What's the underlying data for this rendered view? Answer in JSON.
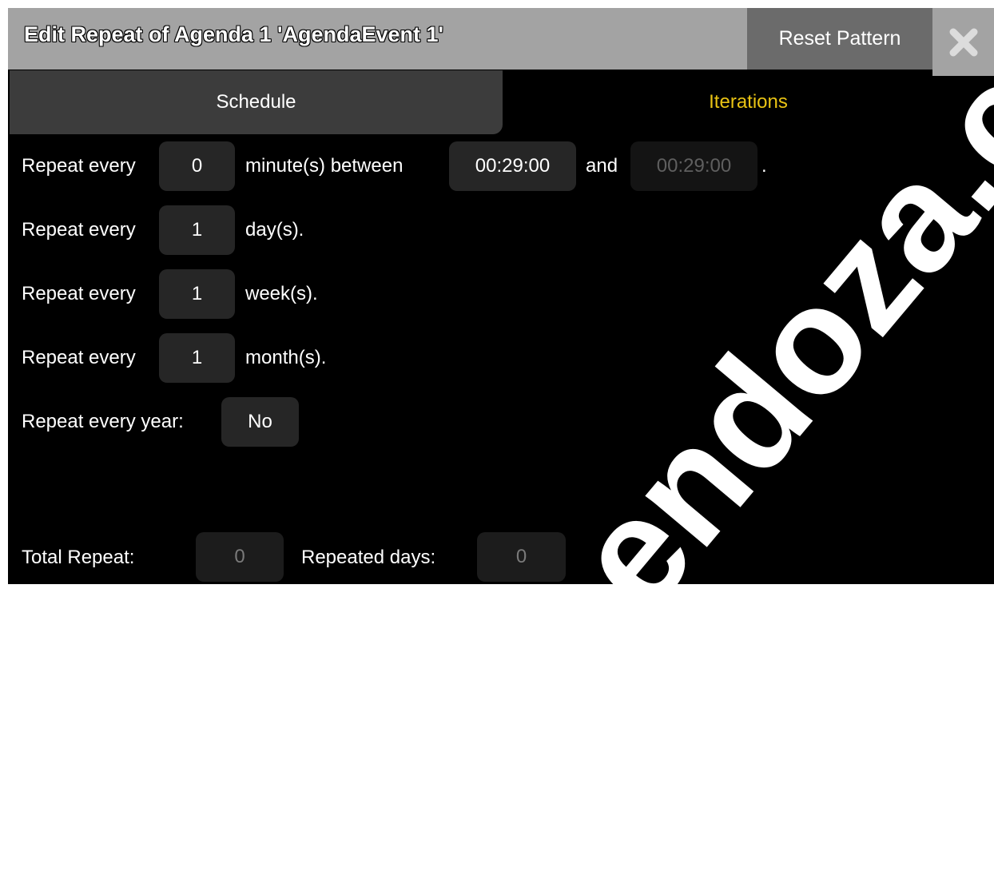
{
  "window": {
    "title": "Edit Repeat of Agenda 1 'AgendaEvent 1'",
    "reset_label": "Reset Pattern",
    "close_icon": "close-x-icon"
  },
  "tabs": {
    "schedule": "Schedule",
    "iterations": "Iterations",
    "active": "Schedule"
  },
  "rows": {
    "minutes": {
      "prefix": "Repeat every",
      "value": "0",
      "middle": "minute(s) between",
      "start": "00:29:00",
      "and": "and",
      "end": "00:29:00",
      "suffix": "."
    },
    "days": {
      "prefix": "Repeat every",
      "value": "1",
      "suffix": "day(s)."
    },
    "weeks": {
      "prefix": "Repeat every",
      "value": "1",
      "suffix": "week(s)."
    },
    "months": {
      "prefix": "Repeat every",
      "value": "1",
      "suffix": "month(s)."
    },
    "year": {
      "label": "Repeat every year:",
      "value": "No"
    }
  },
  "footer": {
    "total_label": "Total Repeat:",
    "total_value": "0",
    "days_label": "Repeated days:",
    "days_value": "0"
  },
  "watermark": "asmendoza.com",
  "colors": {
    "title_bar": "#a3a3a3",
    "reset_button": "#6b6b6b",
    "active_tab": "#3c3c3c",
    "inactive_tab_text": "#e9c314",
    "field_background": "#262626"
  }
}
